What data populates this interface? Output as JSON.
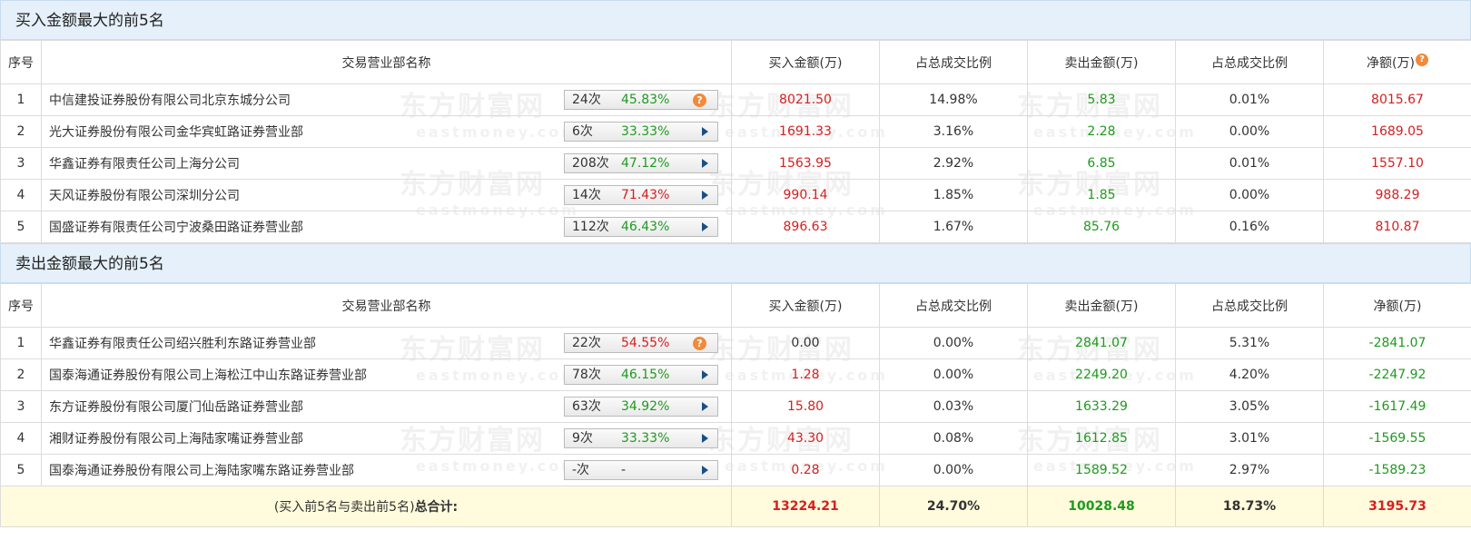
{
  "buy_section": {
    "title": "买入金额最大的前5名",
    "headers": [
      "序号",
      "交易营业部名称",
      "买入金额(万)",
      "占总成交比例",
      "卖出金额(万)",
      "占总成交比例",
      "净额(万)"
    ],
    "rows": [
      {
        "idx": "1",
        "name": "中信建投证券股份有限公司北京东城分公司",
        "count": "24次",
        "pct": "45.83%",
        "buy": "8021.50",
        "buy_ratio": "14.98%",
        "sell": "5.83",
        "sell_ratio": "0.01%",
        "net": "8015.67"
      },
      {
        "idx": "2",
        "name": "光大证券股份有限公司金华宾虹路证券营业部",
        "count": "6次",
        "pct": "33.33%",
        "buy": "1691.33",
        "buy_ratio": "3.16%",
        "sell": "2.28",
        "sell_ratio": "0.00%",
        "net": "1689.05"
      },
      {
        "idx": "3",
        "name": "华鑫证券有限责任公司上海分公司",
        "count": "208次",
        "pct": "47.12%",
        "buy": "1563.95",
        "buy_ratio": "2.92%",
        "sell": "6.85",
        "sell_ratio": "0.01%",
        "net": "1557.10"
      },
      {
        "idx": "4",
        "name": "天风证券股份有限公司深圳分公司",
        "count": "14次",
        "pct": "71.43%",
        "buy": "990.14",
        "buy_ratio": "1.85%",
        "sell": "1.85",
        "sell_ratio": "0.00%",
        "net": "988.29"
      },
      {
        "idx": "5",
        "name": "国盛证券有限责任公司宁波桑田路证券营业部",
        "count": "112次",
        "pct": "46.43%",
        "buy": "896.63",
        "buy_ratio": "1.67%",
        "sell": "85.76",
        "sell_ratio": "0.16%",
        "net": "810.87"
      }
    ]
  },
  "sell_section": {
    "title": "卖出金额最大的前5名",
    "headers": [
      "序号",
      "交易营业部名称",
      "买入金额(万)",
      "占总成交比例",
      "卖出金额(万)",
      "占总成交比例",
      "净额(万)"
    ],
    "rows": [
      {
        "idx": "1",
        "name": "华鑫证券有限责任公司绍兴胜利东路证券营业部",
        "count": "22次",
        "pct": "54.55%",
        "buy": "0.00",
        "buy_ratio": "0.00%",
        "sell": "2841.07",
        "sell_ratio": "5.31%",
        "net": "-2841.07"
      },
      {
        "idx": "2",
        "name": "国泰海通证券股份有限公司上海松江中山东路证券营业部",
        "count": "78次",
        "pct": "46.15%",
        "buy": "1.28",
        "buy_ratio": "0.00%",
        "sell": "2249.20",
        "sell_ratio": "4.20%",
        "net": "-2247.92"
      },
      {
        "idx": "3",
        "name": "东方证券股份有限公司厦门仙岳路证券营业部",
        "count": "63次",
        "pct": "34.92%",
        "buy": "15.80",
        "buy_ratio": "0.03%",
        "sell": "1633.29",
        "sell_ratio": "3.05%",
        "net": "-1617.49"
      },
      {
        "idx": "4",
        "name": "湘财证券股份有限公司上海陆家嘴证券营业部",
        "count": "9次",
        "pct": "33.33%",
        "buy": "43.30",
        "buy_ratio": "0.08%",
        "sell": "1612.85",
        "sell_ratio": "3.01%",
        "net": "-1569.55"
      },
      {
        "idx": "5",
        "name": "国泰海通证券股份有限公司上海陆家嘴东路证券营业部",
        "count": "-次",
        "pct": "-",
        "buy": "0.28",
        "buy_ratio": "0.00%",
        "sell": "1589.52",
        "sell_ratio": "2.97%",
        "net": "-1589.23"
      }
    ]
  },
  "total": {
    "label_prefix": "(买入前5名与卖出前5名)",
    "label_bold": "总合计:",
    "buy": "13224.21",
    "buy_ratio": "24.70%",
    "sell": "10028.48",
    "sell_ratio": "18.73%",
    "net": "3195.73"
  },
  "watermark": {
    "zh": "东方财富网",
    "en": "eastmoney.com"
  },
  "help_glyph": "?",
  "colors": {
    "red": "#d42020",
    "green": "#1f9a1f",
    "header_bg": "#e5f0fa",
    "total_bg": "#fffbdc",
    "help": "#f08a3c"
  }
}
